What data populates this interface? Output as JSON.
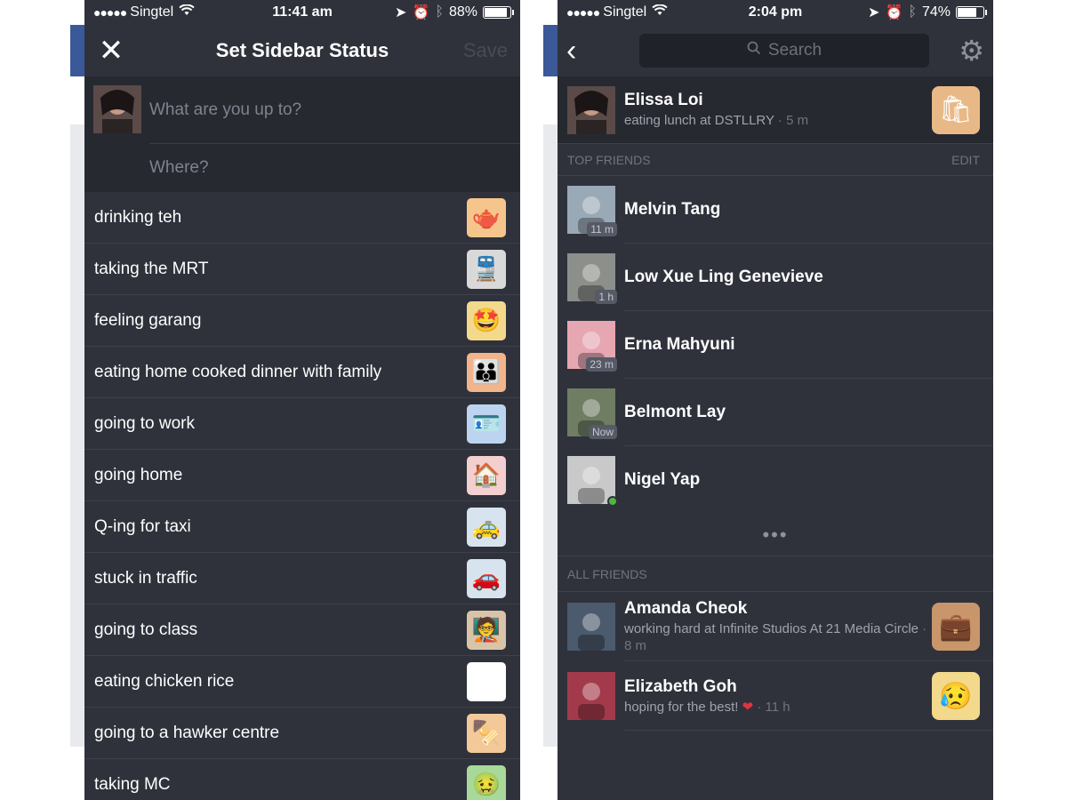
{
  "left": {
    "statusbar": {
      "carrier": "Singtel",
      "time": "11:41 am",
      "battery": "88%",
      "battery_level": 0.88
    },
    "header": {
      "title": "Set Sidebar Status",
      "save_label": "Save"
    },
    "compose": {
      "what_placeholder": "What are you up to?",
      "where_placeholder": "Where?"
    },
    "items": [
      {
        "label": "drinking teh",
        "icon": "teapot-icon",
        "glyph": "🫖",
        "bg": "#f6c58c"
      },
      {
        "label": "taking the MRT",
        "icon": "train-icon",
        "glyph": "🚆",
        "bg": "#d9d9d9"
      },
      {
        "label": "feeling garang",
        "icon": "star-eyes-icon",
        "glyph": "🤩",
        "bg": "#f3d98c"
      },
      {
        "label": "eating home cooked dinner with family",
        "icon": "family-icon",
        "glyph": "👪",
        "bg": "#f2b48a"
      },
      {
        "label": "going to work",
        "icon": "id-badge-icon",
        "glyph": "🪪",
        "bg": "#bcd4ef"
      },
      {
        "label": "going home",
        "icon": "house-icon",
        "glyph": "🏠",
        "bg": "#f4cfd0"
      },
      {
        "label": "Q-ing for taxi",
        "icon": "taxi-icon",
        "glyph": "🚕",
        "bg": "#d8e3f0"
      },
      {
        "label": "stuck in traffic",
        "icon": "car-icon",
        "glyph": "🚗",
        "bg": "#d8e3f0"
      },
      {
        "label": "going to class",
        "icon": "chalkboard-icon",
        "glyph": "🧑‍🏫",
        "bg": "#d9c4a9"
      },
      {
        "label": "eating chicken rice",
        "icon": "plate-icon",
        "glyph": "🍽",
        "bg": "#ffffff"
      },
      {
        "label": "going to a hawker centre",
        "icon": "satay-icon",
        "glyph": "🍢",
        "bg": "#f3c99a"
      },
      {
        "label": "taking MC",
        "icon": "sick-face-icon",
        "glyph": "🤢",
        "bg": "#a9d99a"
      }
    ]
  },
  "right": {
    "statusbar": {
      "carrier": "Singtel",
      "time": "2:04 pm",
      "battery": "74%",
      "battery_level": 0.74
    },
    "search_placeholder": "Search",
    "me": {
      "name": "Elissa Loi",
      "status": "eating lunch at DSTLLRY",
      "time": "5 m",
      "sticker": "lunch-bag-icon",
      "glyph": "🛍",
      "bg": "#e8b987"
    },
    "top_friends": {
      "heading": "TOP FRIENDS",
      "edit": "EDIT"
    },
    "top": [
      {
        "name": "Melvin Tang",
        "badge": "11 m",
        "online": false,
        "avatar_bg": "#9aa9b6"
      },
      {
        "name": "Low Xue Ling Genevieve",
        "badge": "1 h",
        "online": false,
        "avatar_bg": "#8c8f8a"
      },
      {
        "name": "Erna Mahyuni",
        "badge": "23 m",
        "online": false,
        "avatar_bg": "#e6a7b2"
      },
      {
        "name": "Belmont Lay",
        "badge": "Now",
        "online": false,
        "avatar_bg": "#6f7d63"
      },
      {
        "name": "Nigel Yap",
        "badge": "",
        "online": true,
        "avatar_bg": "#c9c9c9"
      }
    ],
    "more": "•••",
    "all_friends": {
      "heading": "ALL FRIENDS"
    },
    "all": [
      {
        "name": "Amanda Cheok",
        "status": "working hard at Infinite Studios At 21 Media Circle",
        "time": "8 m",
        "sticker": "briefcase-icon",
        "glyph": "💼",
        "bg": "#c9966b",
        "avatar_bg": "#4b5a6c"
      },
      {
        "name": "Elizabeth Goh",
        "status": "hoping for the best!",
        "heart": "❤️",
        "time": "11 h",
        "sticker": "crying-face-icon",
        "glyph": "😥",
        "bg": "#f3d98c",
        "avatar_bg": "#a33a4b"
      }
    ]
  }
}
